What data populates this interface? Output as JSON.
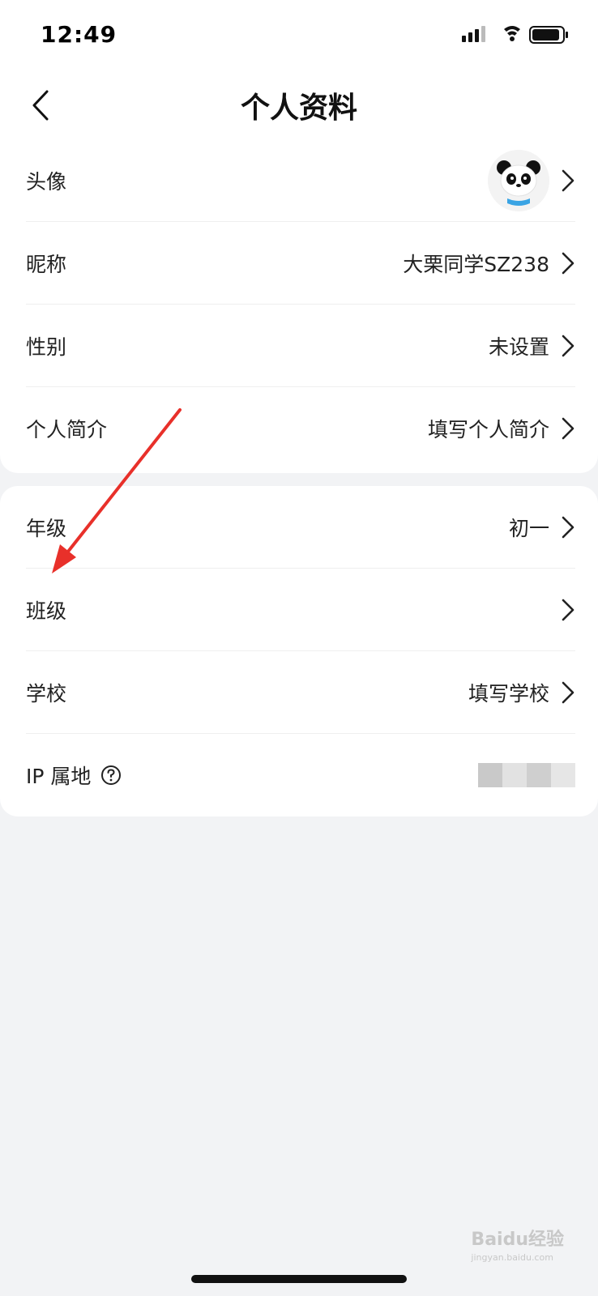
{
  "status_bar": {
    "time": "12:49"
  },
  "nav": {
    "title": "个人资料"
  },
  "section_basic": [
    {
      "label": "头像",
      "value": ""
    },
    {
      "label": "昵称",
      "value": "大栗同学SZ238"
    },
    {
      "label": "性别",
      "value": "未设置"
    },
    {
      "label": "个人简介",
      "value": "填写个人简介"
    }
  ],
  "section_school": [
    {
      "label": "年级",
      "value": "初一"
    },
    {
      "label": "班级",
      "value": ""
    },
    {
      "label": "学校",
      "value": "填写学校"
    },
    {
      "label": "IP 属地",
      "value": ""
    }
  ],
  "watermark": {
    "brand": "Baidu经验",
    "url": "jingyan.baidu.com"
  },
  "colors": {
    "annotation_arrow": "#e8302a",
    "page_bg": "#f2f3f5"
  }
}
